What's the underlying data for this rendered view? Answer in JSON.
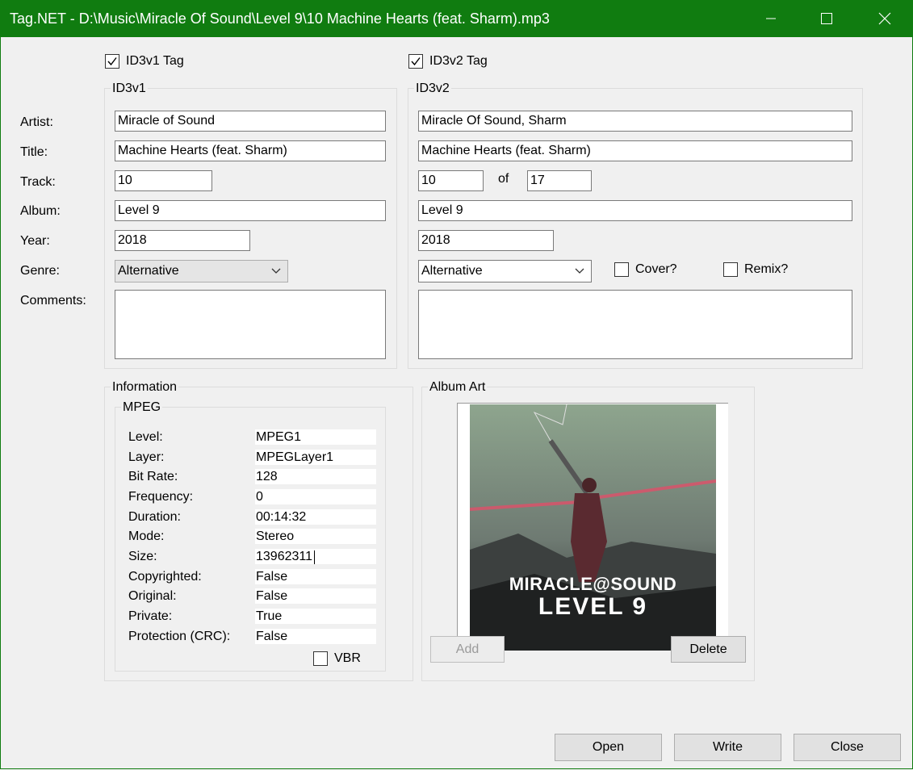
{
  "window": {
    "title": "Tag.NET - D:\\Music\\Miracle Of Sound\\Level 9\\10 Machine Hearts (feat. Sharm).mp3"
  },
  "tags": {
    "id3v1_label": "ID3v1 Tag",
    "id3v1_checked": true,
    "id3v2_label": "ID3v2 Tag",
    "id3v2_checked": true
  },
  "labels": {
    "artist": "Artist:",
    "title": "Title:",
    "track": "Track:",
    "album": "Album:",
    "year": "Year:",
    "genre": "Genre:",
    "comments": "Comments:"
  },
  "id3v1": {
    "legend": "ID3v1",
    "artist": "Miracle of Sound",
    "title": "Machine Hearts (feat. Sharm)",
    "track": "10",
    "album": "Level 9",
    "year": "2018",
    "genre": "Alternative",
    "comments": ""
  },
  "id3v2": {
    "legend": "ID3v2",
    "artist": "Miracle Of Sound, Sharm",
    "title": "Machine Hearts (feat. Sharm)",
    "track": "10",
    "of_label": "of",
    "track_total": "17",
    "album": "Level 9",
    "year": "2018",
    "genre": "Alternative",
    "cover_label": "Cover?",
    "remix_label": "Remix?",
    "comments": ""
  },
  "information": {
    "legend": "Information",
    "mpeg_legend": "MPEG",
    "rows": [
      {
        "label": "Level:",
        "value": "MPEG1"
      },
      {
        "label": "Layer:",
        "value": "MPEGLayer1"
      },
      {
        "label": "Bit Rate:",
        "value": "128"
      },
      {
        "label": "Frequency:",
        "value": "0"
      },
      {
        "label": "Duration:",
        "value": "00:14:32"
      },
      {
        "label": "Mode:",
        "value": "Stereo"
      },
      {
        "label": "Size:",
        "value": "13962311"
      },
      {
        "label": "Copyrighted:",
        "value": "False"
      },
      {
        "label": "Original:",
        "value": "False"
      },
      {
        "label": "Private:",
        "value": "True"
      },
      {
        "label": "Protection (CRC):",
        "value": "False"
      }
    ],
    "vbr_label": "VBR"
  },
  "album_art": {
    "legend": "Album Art",
    "art_line1": "MIRACLE@SOUND",
    "art_line2": "LEVEL 9",
    "add_label": "Add",
    "delete_label": "Delete"
  },
  "buttons": {
    "open": "Open",
    "write": "Write",
    "close": "Close"
  },
  "colors": {
    "titlebar": "#107c10",
    "window_bg": "#f0f0f0"
  }
}
